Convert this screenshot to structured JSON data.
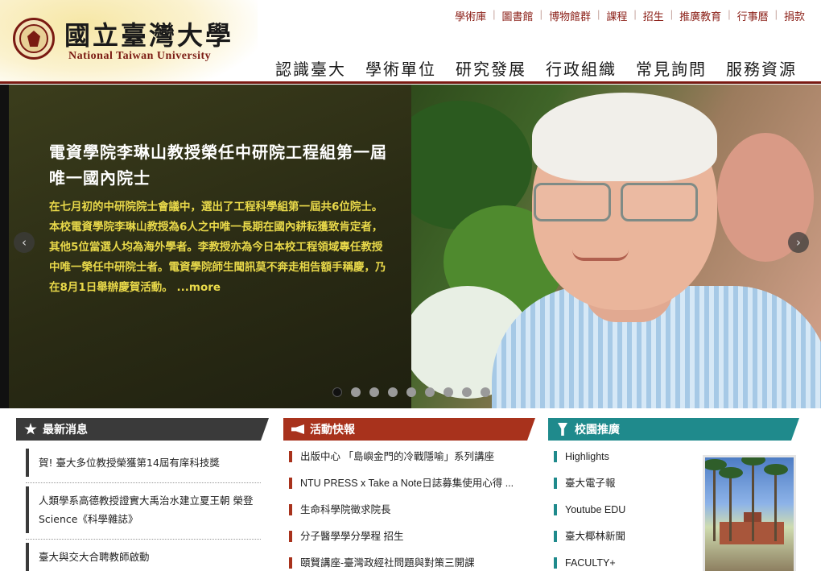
{
  "header": {
    "brand_cn": "國立臺灣大學",
    "brand_en": "National Taiwan University",
    "top_links": [
      "學術庫",
      "圖書館",
      "博物館群",
      "課程",
      "招生",
      "推廣教育",
      "行事曆",
      "捐款"
    ],
    "main_nav": [
      "認識臺大",
      "學術單位",
      "研究發展",
      "行政組織",
      "常見詢問",
      "服務資源"
    ]
  },
  "hero": {
    "title": "電資學院李琳山教授榮任中研院工程組第一屆唯一國內院士",
    "body": "在七月初的中研院院士會議中，選出了工程科學組第一屆共6位院士。本校電資學院李琳山教授為6人之中唯一長期在國內耕耘獲致肯定者，其他5位當選人均為海外學者。李教授亦為今日本校工程領域專任教授中唯一榮任中研院士者。電資學院師生聞訊莫不奔走相告額手稱慶，乃在8月1日舉辦慶賀活動。",
    "more": "...more",
    "slide_count": 9,
    "active_slide": 1
  },
  "news": {
    "heading": "最新消息",
    "items": [
      "賀! 臺大多位教授榮獲第14屆有庠科技獎",
      "人類學系高德教授證實大禹治水建立夏王朝 榮登Science《科學雜誌》",
      "臺大與交大合聘教師啟動"
    ]
  },
  "events": {
    "heading": "活動快報",
    "items": [
      "出版中心 「島嶼金門的冷戰隱喻」系列講座",
      "NTU PRESS x Take a Note日誌募集使用心得 ...",
      "生命科學院徵求院長",
      "分子醫學學分學程 招生",
      "頤賢講座-臺灣政經社問題與對策三開課"
    ]
  },
  "campus": {
    "heading": "校園推廣",
    "items": [
      "Highlights",
      "臺大電子報",
      "Youtube EDU",
      "臺大椰林新聞",
      "FACULTY+"
    ]
  },
  "colors": {
    "brand_red": "#8a1e16",
    "news_dark": "#3a3a3a",
    "events_red": "#a8321c",
    "campus_teal": "#1f8a8c",
    "hero_text_yellow": "#e9d94a"
  }
}
